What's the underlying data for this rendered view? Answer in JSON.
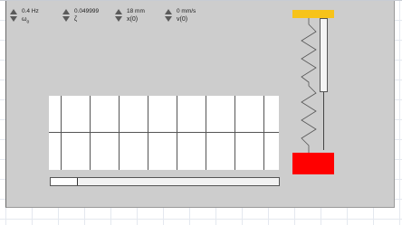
{
  "controls": [
    {
      "value": "0.4 Hz",
      "symbol": "ω",
      "subscript": "o"
    },
    {
      "value": "0.049999",
      "symbol": "ζ",
      "subscript": ""
    },
    {
      "value": "18 mm",
      "symbol": "x(0)",
      "subscript": ""
    },
    {
      "value": "0 mm/s",
      "symbol": "v(0)",
      "subscript": ""
    }
  ],
  "simulation": {
    "progress_fraction": 0.12
  },
  "colors": {
    "background": "#cdcdcd",
    "mass": "#ff0000",
    "ceiling": "#f7c31a"
  }
}
